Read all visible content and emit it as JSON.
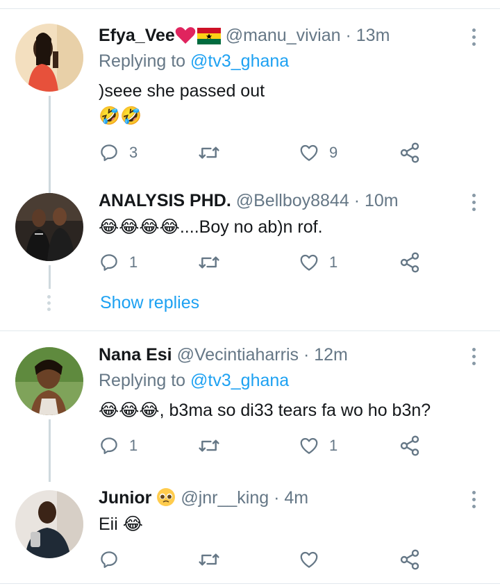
{
  "tweets": [
    {
      "name": "Efya_Vee",
      "handle": "@manu_vivian",
      "time": "13m",
      "replying_prefix": "Replying to ",
      "replying_handle": "@tv3_ghana",
      "text": ")seee she passed out",
      "emoji_line": "🤣🤣",
      "reply_count": "3",
      "like_count": "9"
    },
    {
      "name": "ANALYSIS PHD.",
      "handle": "@Bellboy8844",
      "time": "10m",
      "text_emoji": "😂😂😂😂",
      "text": "....Boy no ab)n rof.",
      "reply_count": "1",
      "like_count": "1",
      "show_replies": "Show replies"
    },
    {
      "name": "Nana Esi",
      "handle": "@Vecintiaharris",
      "time": "12m",
      "replying_prefix": "Replying to ",
      "replying_handle": "@tv3_ghana",
      "text_emoji": "😂😂😂",
      "text": ", b3ma so di33 tears fa wo ho b3n?",
      "reply_count": "1",
      "like_count": "1"
    },
    {
      "name": "Junior",
      "handle": "@jnr__king",
      "time": "4m",
      "text": "Eii",
      "text_emoji": "😂"
    }
  ],
  "separator": "·",
  "colors": {
    "link": "#1da1f2",
    "muted": "#657786",
    "divider": "#e1e8ed",
    "heart_emoji": "#e0245e"
  },
  "icons": [
    "reply-icon",
    "retweet-icon",
    "like-icon",
    "share-icon",
    "more-icon",
    "heart-emoji",
    "ghana-flag-emoji",
    "pleading-face-emoji"
  ]
}
